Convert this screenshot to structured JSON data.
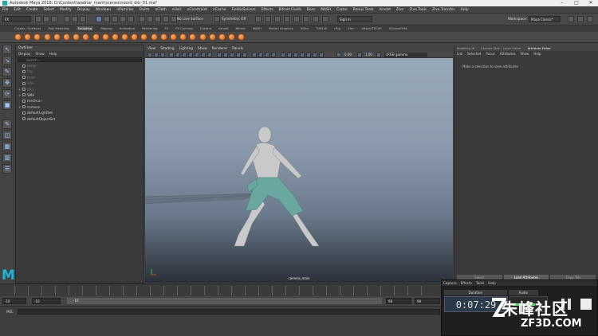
{
  "titlebar": {
    "title": "Autodesk Maya 2018: D:\\Content\\wadnar_mam\\scenes\\noord_dm_01.ma*"
  },
  "menubar": [
    "File",
    "Edit",
    "Create",
    "Select",
    "Modify",
    "Display",
    "Windows",
    "nParticles",
    "Fluids",
    "nCloth",
    "nHair",
    "nConstraint",
    "nCache",
    "Fields/Solvers",
    "Effects",
    "Bifrost Fluids",
    "Boss",
    "MASH",
    "Cache",
    "Bonus Tools",
    "Arnold",
    "Zivo",
    "Zivo Tools",
    "Zivo Transfer",
    "Help"
  ],
  "statusline": {
    "mode": "FX",
    "surface": "No Live Surface",
    "symmetry": "Symmetry: Off",
    "signin": "Sign In",
    "workspace_label": "Workspace:",
    "workspace": "Maya Classic*"
  },
  "shelf": {
    "tabs": [
      "Curves / Surfaces",
      "Poly Modeling",
      "Sculpting",
      "Rigging",
      "Animation",
      "Rendering",
      "FX",
      "FX Caching",
      "Custom",
      "Arnold",
      "Bifrost",
      "MASH",
      "Motion Graphics",
      "XGen",
      "TURTLE",
      "rRig",
      "Xfen",
      "xRays/TSCVR",
      "XGenarOHA"
    ],
    "active_tab": "Sculpting",
    "tool_count": 24
  },
  "outliner": {
    "title": "Outliner",
    "menu": [
      "Display",
      "Show",
      "Help"
    ],
    "search_placeholder": "Search...",
    "items": [
      {
        "label": "persp",
        "dim": true,
        "expand": ""
      },
      {
        "label": "top",
        "dim": true,
        "expand": ""
      },
      {
        "label": "front",
        "dim": true,
        "expand": ""
      },
      {
        "label": "side",
        "dim": true,
        "expand": ""
      },
      {
        "label": "DE1",
        "dim": true,
        "expand": "+"
      },
      {
        "label": "SM4",
        "dim": false,
        "expand": "+"
      },
      {
        "label": "meshcur",
        "dim": false,
        "expand": ""
      },
      {
        "label": "camera",
        "dim": false,
        "expand": "+"
      },
      {
        "label": "defaultLightSet",
        "dim": false,
        "expand": ""
      },
      {
        "label": "defaultObjectSet",
        "dim": false,
        "expand": ""
      }
    ]
  },
  "viewport": {
    "menu": [
      "View",
      "Shading",
      "Lighting",
      "Show",
      "Renderer",
      "Panels"
    ],
    "exposure": "0.00",
    "gamma": "1.00",
    "colorspace": "sRGB gamma",
    "camera": "camera_main"
  },
  "attribute_editor": {
    "tabs": [
      "Modeling IK",
      "Channel Box / Layer Editor",
      "Attribute Editor"
    ],
    "active_tab": "Attribute Editor",
    "menu": [
      "List",
      "Selected",
      "Focus",
      "Attributes",
      "Show",
      "Help"
    ],
    "message": "Make a selection to view attributes",
    "buttons": [
      "Select",
      "Load Attributes",
      "Copy Tab"
    ]
  },
  "range": {
    "start": "-10",
    "anim_start": "-10",
    "range_label": "-10",
    "anim_end": "98",
    "end": "98",
    "current": "98"
  },
  "cmdline": {
    "label": "MEL"
  },
  "capture": {
    "menu": [
      "Capture",
      "Effects",
      "Tools",
      "Help"
    ],
    "duration_label": "Duration",
    "audio_label": "Audio",
    "time": "0:07:29"
  },
  "watermark": {
    "cn": "朱峰社区",
    "en": "ZF3D.COM"
  },
  "colors": {
    "accent": "#1fb4d8",
    "shelf_tool": "#e0823a",
    "viewport_top": "#97a8b9"
  }
}
